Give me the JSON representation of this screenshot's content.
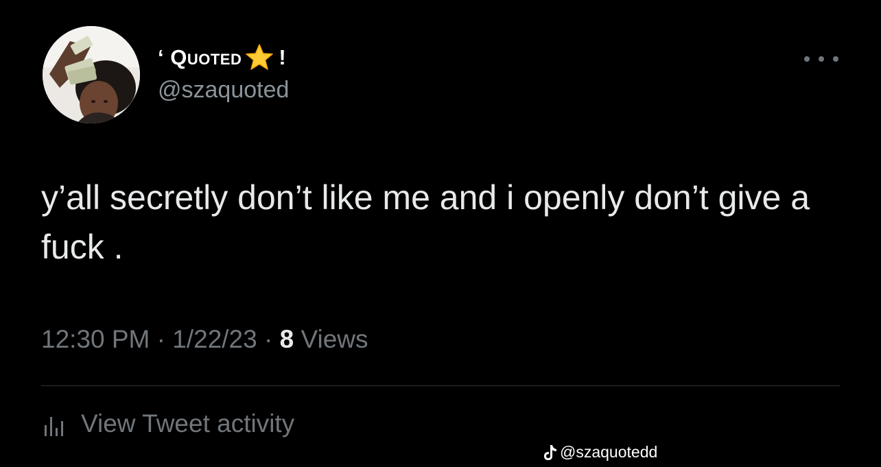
{
  "tweet": {
    "author": {
      "display_name_prefix": "‘ Quoted",
      "display_name_suffix": "!",
      "badge_icon": "star-icon",
      "handle": "@szaquoted"
    },
    "more_icon": "ellipsis-icon",
    "text": "y’all secretly don’t like me and i openly don’t give a fuck .",
    "meta": {
      "time": "12:30 PM",
      "separator_1": " · ",
      "date": "1/22/23",
      "separator_2": " · ",
      "views_count": "8",
      "views_label": " Views"
    },
    "activity": {
      "icon": "analytics-icon",
      "label": "View Tweet activity"
    }
  },
  "watermark": {
    "icon": "tiktok-icon",
    "text": "@szaquotedd"
  },
  "colors": {
    "background": "#000000",
    "text_primary": "#e7e9ea",
    "text_secondary": "#71767b",
    "divider": "#2f3336",
    "star": "#ffcc33"
  }
}
